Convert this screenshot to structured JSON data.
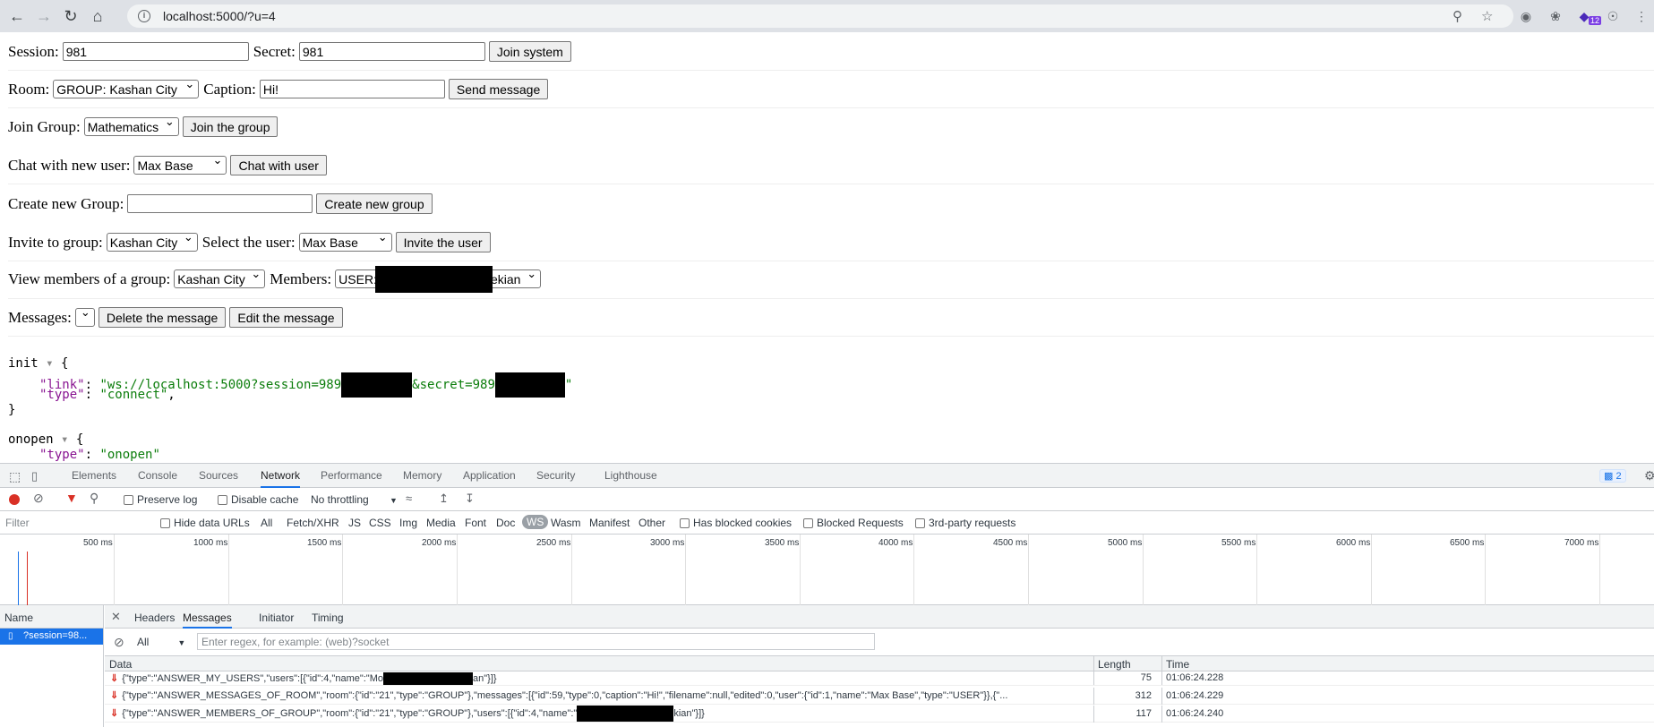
{
  "browser": {
    "url": "localhost:5000/?u=4",
    "ext_badge": "12"
  },
  "form": {
    "session_label": "Session:",
    "session_value": "981",
    "secret_label": "Secret:",
    "secret_value": "981",
    "join_system": "Join system",
    "room_label": "Room:",
    "room_value": "GROUP: Kashan City",
    "caption_label": "Caption:",
    "caption_value": "Hi!",
    "send_message": "Send message",
    "join_group_label": "Join Group:",
    "join_group_value": "Mathematics",
    "join_group_btn": "Join the group",
    "chat_new_label": "Chat with new user:",
    "chat_new_value": "Max Base",
    "chat_with_user": "Chat with user",
    "create_group_label": "Create new Group:",
    "create_group_value": "",
    "create_group_btn": "Create new group",
    "invite_label": "Invite to group:",
    "invite_group_value": "Kashan City",
    "select_user_label": "Select the user:",
    "select_user_value": "Max Base",
    "invite_btn": "Invite the user",
    "view_members_label": "View members of a group:",
    "view_members_value": "Kashan City",
    "members_label": "Members:",
    "members_value_start": "USER:",
    "members_value_end": "ekian",
    "messages_label": "Messages:",
    "delete_msg": "Delete the message",
    "edit_msg": "Edit the message"
  },
  "log": {
    "init_key": "init",
    "link_key": "\"link\"",
    "link_val_a": "\"ws://localhost:5000?session=989",
    "link_val_b": "&secret=989",
    "link_val_c": "\"",
    "type_key": "\"type\"",
    "type_val": "\"connect\"",
    "onopen_key": "onopen",
    "onopen_type_val": "\"onopen\""
  },
  "devtools": {
    "tabs": [
      "Elements",
      "Console",
      "Sources",
      "Network",
      "Performance",
      "Memory",
      "Application",
      "Security",
      "Lighthouse"
    ],
    "issues_count": "2",
    "preserve_log": "Preserve log",
    "disable_cache": "Disable cache",
    "throttling": "No throttling",
    "filter_placeholder": "Filter",
    "hide_data_urls": "Hide data URLs",
    "filter_types": [
      "All",
      "Fetch/XHR",
      "JS",
      "CSS",
      "Img",
      "Media",
      "Font",
      "Doc",
      "WS",
      "Wasm",
      "Manifest",
      "Other"
    ],
    "has_blocked_cookies": "Has blocked cookies",
    "blocked_requests": "Blocked Requests",
    "third_party": "3rd-party requests",
    "timeline_labels": [
      "500 ms",
      "1000 ms",
      "1500 ms",
      "2000 ms",
      "2500 ms",
      "3000 ms",
      "3500 ms",
      "4000 ms",
      "4500 ms",
      "5000 ms",
      "5500 ms",
      "6000 ms",
      "6500 ms",
      "7000 ms"
    ],
    "name_header": "Name",
    "request_name": "?session=98...",
    "detail_tabs": [
      "Headers",
      "Messages",
      "Initiator",
      "Timing"
    ],
    "msg_filter_all": "All",
    "msg_filter_placeholder": "Enter regex, for example: (web)?socket",
    "col_data": "Data",
    "col_length": "Length",
    "col_time": "Time",
    "messages": [
      {
        "data_a": "{\"type\":\"ANSWER_MY_USERS\",\"users\":[{\"id\":4,\"name\":\"Mo",
        "data_b": "an\"}]}",
        "length": "75",
        "time": "01:06:24.228"
      },
      {
        "data_a": "{\"type\":\"ANSWER_MESSAGES_OF_ROOM\",\"room\":{\"id\":\"21\",\"type\":\"GROUP\"},\"messages\":[{\"id\":59,\"type\":0,\"caption\":\"Hi!\",\"filename\":null,\"edited\":0,\"user\":{\"id\":1,\"name\":\"Max Base\",\"type\":\"USER\"}},{\"...",
        "data_b": "",
        "length": "312",
        "time": "01:06:24.229"
      },
      {
        "data_a": "{\"type\":\"ANSWER_MEMBERS_OF_GROUP\",\"room\":{\"id\":\"21\",\"type\":\"GROUP\"},\"users\":[{\"id\":4,\"name\":\"",
        "data_b": "kian\"}]}",
        "length": "117",
        "time": "01:06:24.240"
      }
    ]
  }
}
